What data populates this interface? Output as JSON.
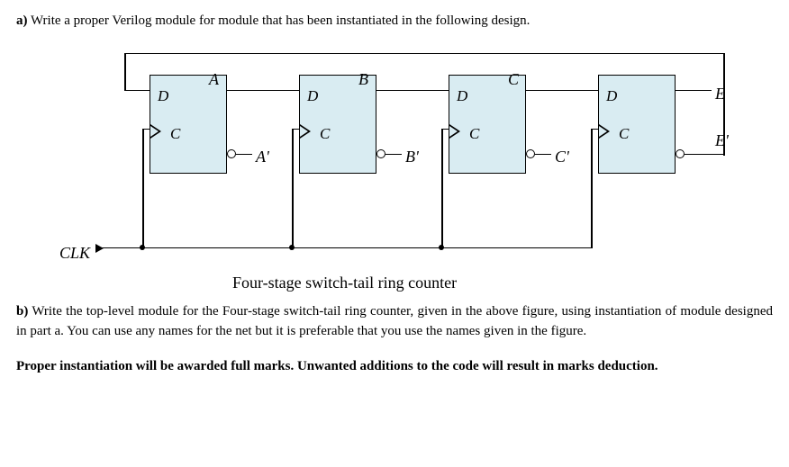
{
  "partA": {
    "label": "a)",
    "text": "Write a proper Verilog module for module that has been instantiated in the following design."
  },
  "figure": {
    "ff_pin_D": "D",
    "ff_pin_C": "C",
    "nets": {
      "A": "A",
      "B": "B",
      "C": "C",
      "E": "E",
      "Ap": "A'",
      "Bp": "B'",
      "Cp": "C'",
      "Ep": "E'"
    },
    "clk": "CLK",
    "caption": "Four-stage switch-tail ring counter"
  },
  "partB": {
    "label": "b)",
    "text": "Write the top-level module for the Four-stage switch-tail ring counter, given in the above figure, using instantiation of module designed in part a. You can use any names for the net but it is preferable that you use the names given in the figure."
  },
  "note": "Proper instantiation will be awarded full marks. Unwanted additions to the code will result in marks deduction."
}
